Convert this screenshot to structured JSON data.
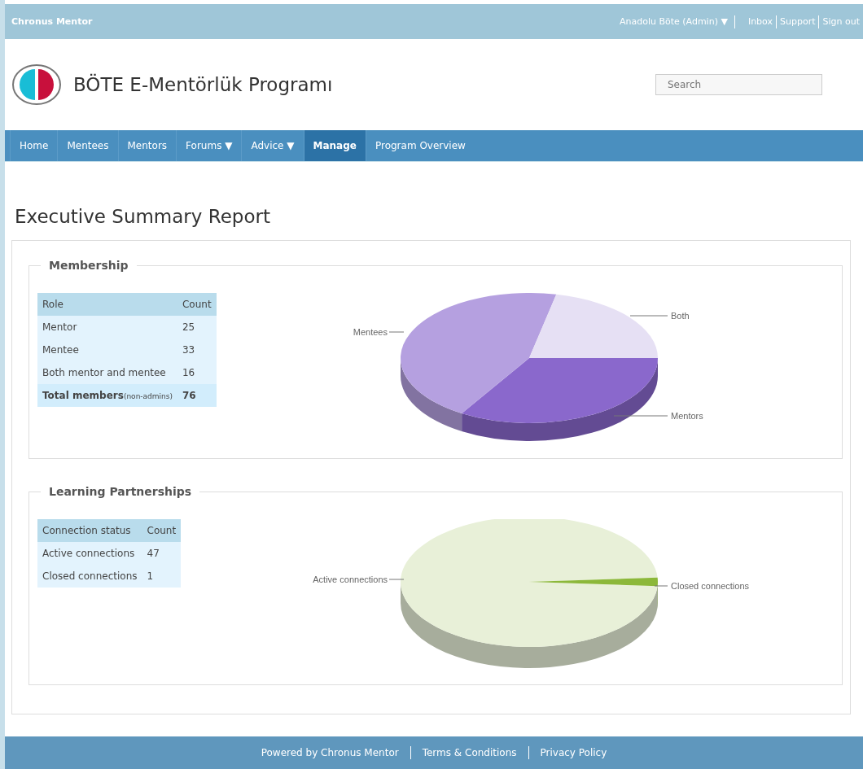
{
  "top_bar": {
    "brand": "Chronus Mentor",
    "user_menu": "Anadolu Böte (Admin) ▼",
    "links": [
      "Inbox",
      "Support",
      "Sign out"
    ]
  },
  "header": {
    "title": "BÖTE E-Mentörlük Programı",
    "search": {
      "placeholder": "Search"
    }
  },
  "nav": [
    {
      "label": "Home",
      "selected": false
    },
    {
      "label": "Mentees",
      "selected": false
    },
    {
      "label": "Mentors",
      "selected": false
    },
    {
      "label": "Forums ▼",
      "selected": false
    },
    {
      "label": "Advice ▼",
      "selected": false
    },
    {
      "label": "Manage",
      "selected": true
    },
    {
      "label": "Program Overview",
      "selected": false
    }
  ],
  "page_title": "Executive Summary Report",
  "sections": [
    {
      "title": "Membership",
      "columns": [
        "Role",
        "Count"
      ],
      "rows": [
        {
          "cells": [
            "Mentor",
            "25"
          ],
          "total": false
        },
        {
          "cells": [
            "Mentee",
            "33"
          ],
          "total": false
        },
        {
          "cells": [
            "Both mentor and mentee",
            "16"
          ],
          "total": false
        },
        {
          "cells": [
            "Total members",
            "76"
          ],
          "note": "(non-admins)",
          "total": true
        }
      ],
      "pie": {
        "slices": [
          {
            "label": "Mentors",
            "color": "#8a68cc"
          },
          {
            "label": "Mentees",
            "color": "#b5a0e0"
          },
          {
            "label": "Both",
            "color": "#e6e0f4"
          }
        ]
      }
    },
    {
      "title": "Learning Partnerships",
      "columns": [
        "Connection status",
        "Count"
      ],
      "rows": [
        {
          "cells": [
            "Active connections",
            "47"
          ],
          "total": false
        },
        {
          "cells": [
            "Closed connections",
            "1"
          ],
          "total": false
        }
      ],
      "pie": {
        "slices": [
          {
            "label": "Active connections",
            "color": "#e8f0d8"
          },
          {
            "label": "Closed connections",
            "color": "#8cb83a"
          }
        ]
      }
    }
  ],
  "footer": {
    "links": [
      "Powered by Chronus Mentor",
      "Terms & Conditions",
      "Privacy Policy"
    ]
  }
}
